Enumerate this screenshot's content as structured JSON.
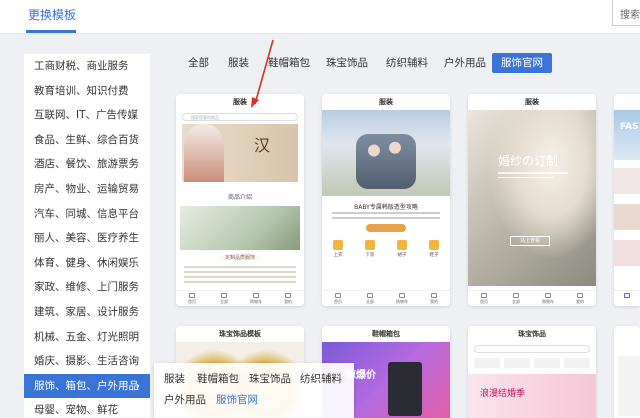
{
  "header": {
    "tab_label": "更换模板",
    "search_text": "搜索"
  },
  "sidebar": {
    "items": [
      {
        "label": "工商财税、商业服务"
      },
      {
        "label": "教育培训、知识付费"
      },
      {
        "label": "互联网、IT、广告传媒"
      },
      {
        "label": "食品、生鲜、综合百货"
      },
      {
        "label": "酒店、餐饮、旅游票务"
      },
      {
        "label": "房产、物业、运输贸易"
      },
      {
        "label": "汽车、同城、信息平台"
      },
      {
        "label": "丽人、美容、医疗养生"
      },
      {
        "label": "体育、健身、休闲娱乐"
      },
      {
        "label": "家政、维修、上门服务"
      },
      {
        "label": "建筑、家居、设计服务"
      },
      {
        "label": "机械、五金、灯光照明"
      },
      {
        "label": "婚庆、摄影、生活咨询"
      },
      {
        "label": "服饰、箱包、户外用品"
      },
      {
        "label": "母婴、宠物、鲜花"
      }
    ],
    "active_index": 13,
    "chevron": "›"
  },
  "filters": {
    "items": [
      "全部",
      "服装",
      "鞋帽箱包",
      "珠宝饰品",
      "纺织辅料",
      "户外用品",
      "服饰官网"
    ],
    "active_index": 6
  },
  "dropdown": {
    "items": [
      "服装",
      "鞋帽箱包",
      "珠宝饰品",
      "纺织辅料",
      "户外用品",
      "服饰官网"
    ]
  },
  "cards": {
    "card1": {
      "title": "服装",
      "search_placeholder": "搜索您要的商品",
      "calligraphy": "汉",
      "section": "商品介绍",
      "label": "· 定制品质服饰 ·"
    },
    "card2": {
      "title": "服装",
      "headline": "BABY专属韩版造型攻略",
      "icons": [
        "上衣",
        "下装",
        "裙子",
        "鞋子"
      ]
    },
    "card3": {
      "title": "服装",
      "headline": "婚纱の订制",
      "button": "马上查看"
    },
    "card4": {
      "brand": "FAS"
    },
    "card5": {
      "title": "珠宝饰品模板"
    },
    "card6": {
      "title": "鞋帽箱包",
      "promo": "惊爆价"
    },
    "card7": {
      "title": "珠宝饰品",
      "headline": "浪漫结婚季"
    }
  },
  "nav": [
    "首页",
    "全部",
    "购物车",
    "我的"
  ],
  "colors": {
    "accent": "#3a74d6",
    "annotation": "#d9302a"
  }
}
